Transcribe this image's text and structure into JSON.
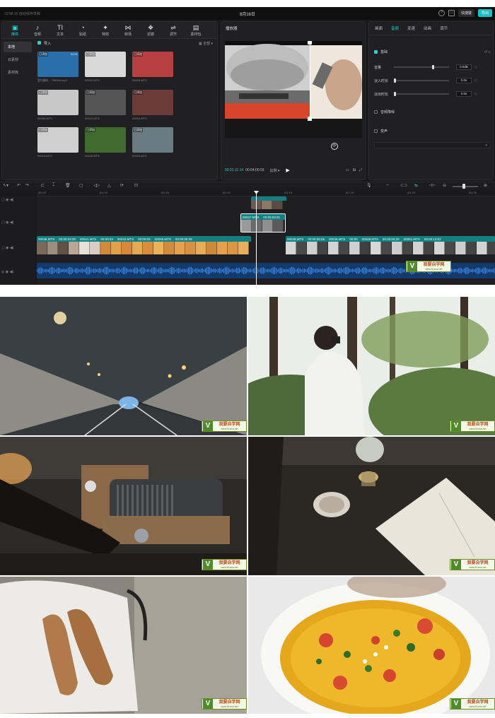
{
  "titlebar": {
    "app": "10:58:15 自动保存草稿",
    "title": "8月16日",
    "shortcut": "快捷键",
    "export": "导出"
  },
  "toolbar": {
    "items": [
      {
        "label": "媒体",
        "glyph": "▣",
        "active": true
      },
      {
        "label": "音频",
        "glyph": "♪"
      },
      {
        "label": "文本",
        "glyph": "TI"
      },
      {
        "label": "贴纸",
        "glyph": "◔"
      },
      {
        "label": "特效",
        "glyph": "✦"
      },
      {
        "label": "转场",
        "glyph": "⋈"
      },
      {
        "label": "滤镜",
        "glyph": "❖"
      },
      {
        "label": "调节",
        "glyph": "⇌"
      },
      {
        "label": "素材包",
        "glyph": "▤"
      }
    ]
  },
  "sidebar": {
    "items": [
      {
        "label": "本地",
        "on": true
      },
      {
        "label": "云素材"
      },
      {
        "label": "素材库"
      }
    ]
  },
  "media": {
    "import": "导入",
    "sort": "全部",
    "items": [
      {
        "tag": "已添加",
        "dur": "04:01",
        "name": "室内婚礼 - 750526.mp3",
        "color": "#2a6fa9"
      },
      {
        "tag": "已添加",
        "dur": "",
        "name": "00002.MTS",
        "color": "#d9d9d9"
      },
      {
        "tag": "已添加",
        "dur": "",
        "name": "00003.MTS",
        "color": "#b84040"
      },
      {
        "tag": "已添加",
        "dur": "",
        "name": "00005.MTS",
        "color": "#c8c8c8"
      },
      {
        "tag": "已添加",
        "dur": "",
        "name": "00012.MTS",
        "color": "#555555"
      },
      {
        "tag": "已添加",
        "dur": "",
        "name": "00016.MTS",
        "color": "#6e3b3b"
      },
      {
        "tag": "已添加",
        "dur": "",
        "name": "00024.MTS",
        "color": "#cfcfcf"
      },
      {
        "tag": "已添加",
        "dur": "",
        "name": "00026.MTS",
        "color": "#3f6b2f"
      },
      {
        "tag": "已添加",
        "dur": "",
        "name": "00029.MTS",
        "color": "#6b7b82"
      }
    ]
  },
  "player": {
    "title": "播放器",
    "current": "00:01:11:14",
    "total": "00:04:00:03",
    "ratio": "比例"
  },
  "inspector": {
    "tabs": [
      {
        "label": "画面"
      },
      {
        "label": "音频",
        "on": true
      },
      {
        "label": "变速"
      },
      {
        "label": "动画"
      },
      {
        "label": "调节"
      }
    ],
    "section": "基础",
    "rows": [
      {
        "label": "音量",
        "val": "0.0dB",
        "pos": 0.72
      },
      {
        "label": "淡入时长",
        "val": "0.0s",
        "pos": 0.0
      },
      {
        "label": "淡出时长",
        "val": "0.0s",
        "pos": 0.0
      }
    ],
    "denoise": "音频降噪",
    "voice": "变声"
  },
  "ruler": {
    "ticks": [
      "|00:00",
      "|01:00",
      "|01:05",
      "|01:10",
      "|01:15",
      "|01:20",
      "|01:25",
      "|01:30"
    ]
  },
  "timeline": {
    "overlay1": {
      "labels": [
        "00047.MTS",
        "00:00:03:21"
      ]
    },
    "main_left": {
      "labels": [
        "00036.MTS",
        "00:00:04:00",
        "00041.MTS",
        "00:00:03",
        "00043.MTS",
        "00:00:03",
        "00045.MTS",
        "00:00:05:28"
      ]
    },
    "main_right": {
      "labels": [
        "00048.MTS",
        "00:00:06:05",
        "00046.MTS",
        "00:00",
        "00048.MTS",
        "00:00:04:20",
        "00051.MTS",
        "00:00:13:02"
      ]
    }
  },
  "watermark": {
    "title": "我要自学网",
    "url": "www.51zxw.net",
    "letter": "V"
  },
  "photos": [
    {
      "name": "tunnel-photo"
    },
    {
      "name": "photographer-forest-photo"
    },
    {
      "name": "tube-amplifier-photo"
    },
    {
      "name": "tea-and-book-photo"
    },
    {
      "name": "woven-shoes-photo"
    },
    {
      "name": "egg-dish-photo"
    }
  ]
}
